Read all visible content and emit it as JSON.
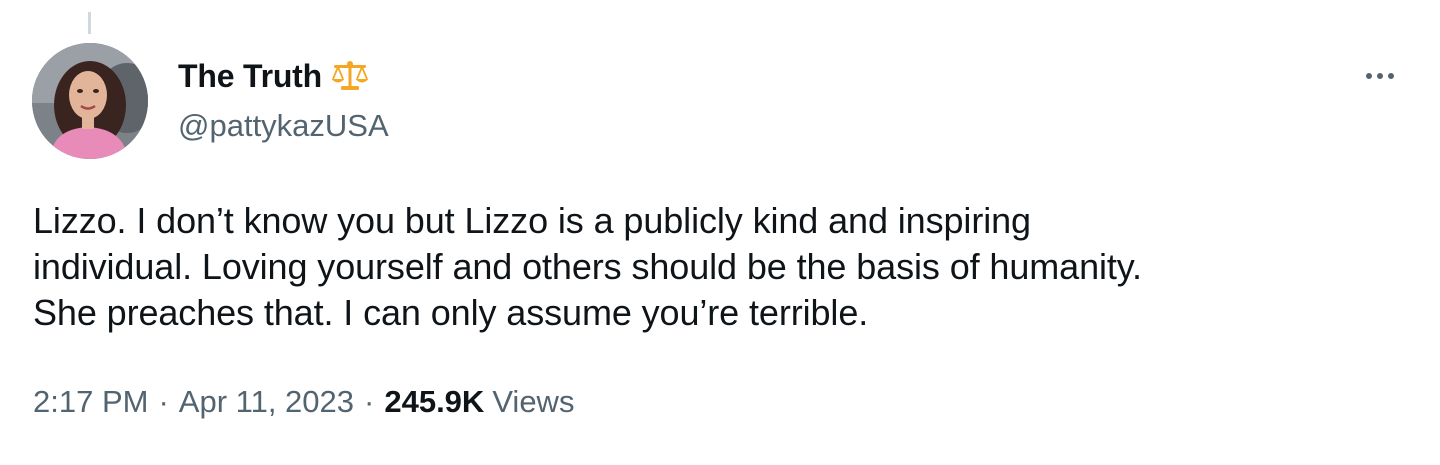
{
  "author": {
    "display_name": "The Truth",
    "name_emoji": "scales-icon",
    "handle": "@pattykazUSA"
  },
  "tweet": {
    "text_lines": [
      "Lizzo. I don’t know you but Lizzo is a publicly kind and inspiring",
      "individual. Loving yourself and others should be the basis of humanity.",
      "She preaches that. I can only assume you’re terrible."
    ],
    "time": "2:17 PM",
    "date": "Apr 11, 2023",
    "separator": "·",
    "views_count": "245.9K",
    "views_label": "Views"
  },
  "colors": {
    "primary_text": "#0f1419",
    "secondary_text": "#536471",
    "emoji_gold": "#f5a623"
  }
}
